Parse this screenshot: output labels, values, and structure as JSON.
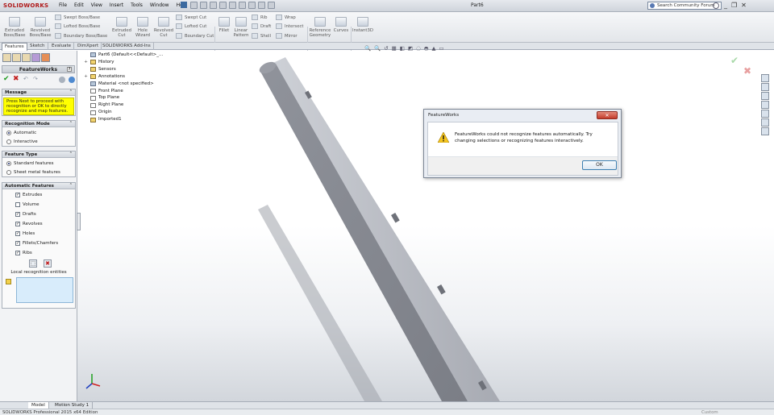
{
  "app": {
    "logo": "SOLIDWORKS",
    "document_title": "Part6",
    "menu": [
      "File",
      "Edit",
      "View",
      "Insert",
      "Tools",
      "Window",
      "Help"
    ],
    "search_placeholder": "Search Community Forum"
  },
  "ribbon": {
    "extruded_boss": "Extruded Boss/Base",
    "revolved_boss": "Revolved Boss/Base",
    "swept_boss": "Swept Boss/Base",
    "lofted_boss": "Lofted Boss/Base",
    "boundary_boss": "Boundary Boss/Base",
    "extruded_cut": "Extruded Cut",
    "hole_wizard": "Hole Wizard",
    "revolved_cut": "Revolved Cut",
    "swept_cut": "Swept Cut",
    "lofted_cut": "Lofted Cut",
    "boundary_cut": "Boundary Cut",
    "fillet": "Fillet",
    "linear_pattern": "Linear Pattern",
    "rib": "Rib",
    "draft": "Draft",
    "shell": "Shell",
    "wrap": "Wrap",
    "intersect": "Intersect",
    "mirror": "Mirror",
    "reference_geometry": "Reference Geometry",
    "curves": "Curves",
    "instant3d": "Instant3D"
  },
  "tabs": [
    "Features",
    "Sketch",
    "Evaluate",
    "DimXpert",
    "SOLIDWORKS Add-Ins"
  ],
  "panel": {
    "title": "FeatureWorks",
    "help_label": "?",
    "message_header": "Message",
    "message_text": "Press Next to proceed with recognition or OK to directly recognize and map features.",
    "recognition_mode_header": "Recognition Mode",
    "recognition_modes": [
      {
        "label": "Automatic",
        "selected": true
      },
      {
        "label": "Interactive",
        "selected": false
      }
    ],
    "feature_type_header": "Feature Type",
    "feature_types": [
      {
        "label": "Standard features",
        "selected": true
      },
      {
        "label": "Sheet metal features",
        "selected": false
      }
    ],
    "auto_features_header": "Automatic Features",
    "auto_features": [
      {
        "label": "Extrudes",
        "checked": true
      },
      {
        "label": "Volume",
        "checked": false
      },
      {
        "label": "Drafts",
        "checked": true
      },
      {
        "label": "Revolves",
        "checked": true
      },
      {
        "label": "Holes",
        "checked": true
      },
      {
        "label": "Fillets/Chamfers",
        "checked": true
      },
      {
        "label": "Ribs",
        "checked": true
      }
    ],
    "local_recognition_label": "Local recognition entities",
    "collapse_glyph": "⌃"
  },
  "tree": {
    "items": [
      {
        "label": "Part6 (Default<<Default>_...",
        "icon": "part",
        "expand": ""
      },
      {
        "label": "History",
        "icon": "folder",
        "expand": "+"
      },
      {
        "label": "Sensors",
        "icon": "folder",
        "expand": ""
      },
      {
        "label": "Annotations",
        "icon": "annotation",
        "expand": "+"
      },
      {
        "label": "Material <not specified>",
        "icon": "material",
        "expand": ""
      },
      {
        "label": "Front Plane",
        "icon": "plane",
        "expand": ""
      },
      {
        "label": "Top Plane",
        "icon": "plane",
        "expand": ""
      },
      {
        "label": "Right Plane",
        "icon": "plane",
        "expand": ""
      },
      {
        "label": "Origin",
        "icon": "origin",
        "expand": ""
      },
      {
        "label": "Imported1",
        "icon": "imported",
        "expand": ""
      }
    ]
  },
  "dialog": {
    "title": "FeatureWorks",
    "message": "FeatureWorks could not recognize features automatically. Try changing selections or recognizing features interactively.",
    "ok_label": "OK",
    "close_glyph": "✕"
  },
  "bottom_tabs": [
    "Model",
    "Motion Study 1"
  ],
  "status": {
    "text": "SOLIDWORKS Professional 2015 x64 Edition",
    "right": "Custom"
  },
  "glyphs": {
    "ok": "✔",
    "cancel": "✖",
    "undo": "↶",
    "redo": "↷",
    "confirm_ok": "✔",
    "confirm_cancel": "✖",
    "win_min": "_",
    "win_restore": "❐",
    "win_close": "✕",
    "delete": "✖",
    "select": "⬚"
  },
  "colors": {
    "message_bg": "#ffff00",
    "part_face": "#8b8e96",
    "part_edge": "#c3c6cd"
  }
}
